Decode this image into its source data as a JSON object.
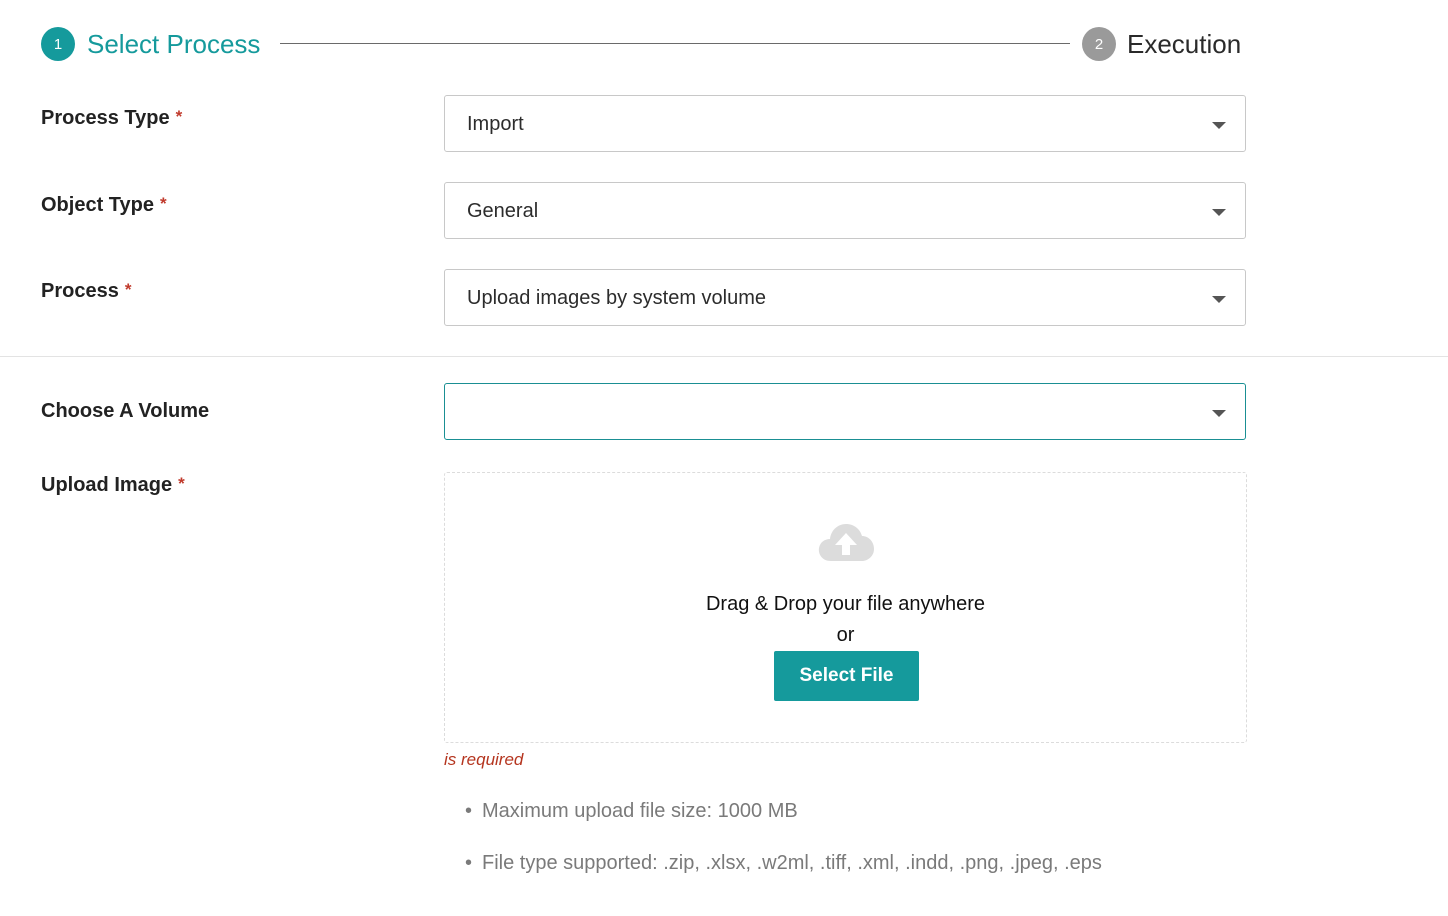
{
  "stepper": {
    "steps": [
      {
        "number": "1",
        "label": "Select Process",
        "state": "active"
      },
      {
        "number": "2",
        "label": "Execution",
        "state": "inactive"
      }
    ]
  },
  "form": {
    "process_type": {
      "label": "Process Type",
      "required": "*",
      "value": "Import"
    },
    "object_type": {
      "label": "Object Type",
      "required": "*",
      "value": "General"
    },
    "process": {
      "label": "Process",
      "required": "*",
      "value": "Upload images by system volume"
    },
    "volume": {
      "label": "Choose A Volume",
      "value": ""
    },
    "upload": {
      "label": "Upload Image",
      "required": "*",
      "icon": "cloud-upload-icon",
      "drop_text": "Drag & Drop your file anywhere",
      "or_text": "or",
      "button_label": "Select File",
      "error": "is required",
      "hints": [
        "Maximum upload file size: 1000 MB",
        "File type supported: .zip, .xlsx, .w2ml, .tiff, .xml, .indd, .png, .jpeg, .eps"
      ]
    }
  },
  "colors": {
    "accent": "#159a9c",
    "inactive_step": "#9a9a9a",
    "required": "#c0392b",
    "error": "#b5351f",
    "hint": "#7a7a7a"
  }
}
